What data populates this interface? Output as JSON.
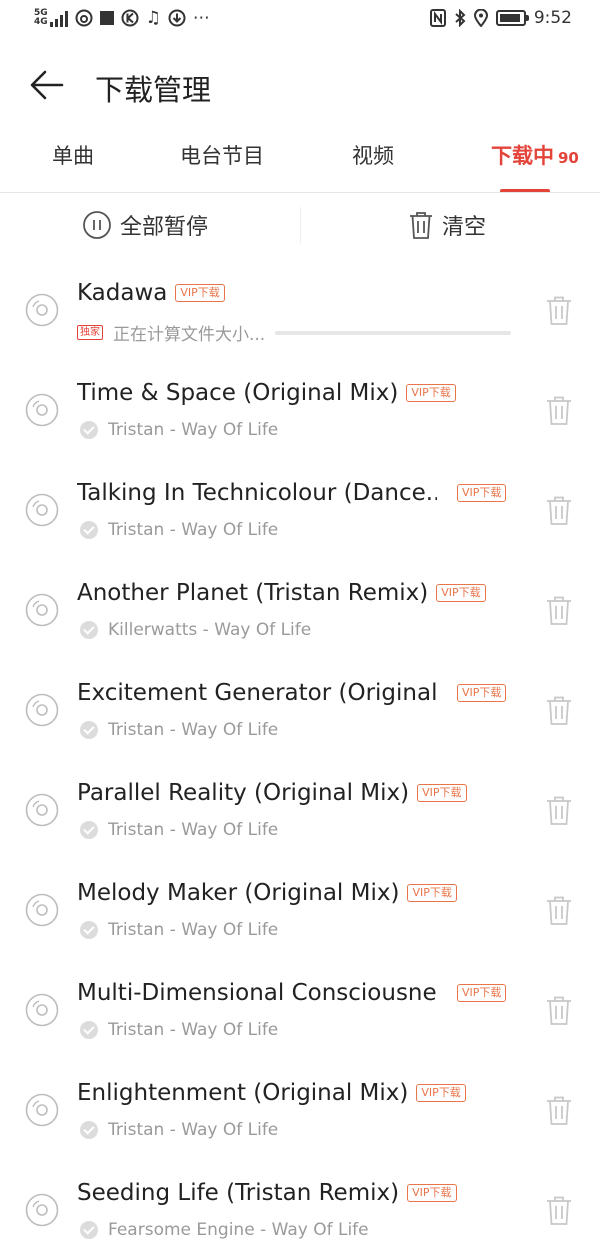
{
  "status_bar": {
    "network": "5G",
    "network_sub": "4G",
    "time": "9:52",
    "battery_level": 0.9,
    "icons": [
      "signal-icon",
      "netease-icon",
      "stop-icon",
      "k-icon",
      "music-note-icon",
      "download-arrow-icon",
      "more-dots-icon",
      "nfc-icon",
      "bluetooth-icon",
      "location-icon",
      "battery-icon"
    ]
  },
  "header": {
    "title": "下载管理",
    "back_icon": "back-arrow-icon"
  },
  "tabs": [
    {
      "label": "单曲"
    },
    {
      "label": "电台节目"
    },
    {
      "label": "视频"
    },
    {
      "label": "下载中",
      "count": "90",
      "active": true
    }
  ],
  "actions": {
    "pause_all": "全部暂停",
    "clear": "清空"
  },
  "colors": {
    "accent": "#e4433a",
    "vip": "#e8754a",
    "muted": "#9a9a9a"
  },
  "downloads": [
    {
      "title": "Kadawa",
      "vip": "VIP下载",
      "status": "正在计算文件大小...",
      "exclusive": "独家",
      "downloading": true
    },
    {
      "title": "Time & Space (Original Mix)",
      "vip": "VIP下载",
      "subtitle": "Tristan - Way Of Life"
    },
    {
      "title": "Talking In Technicolour (Dance...",
      "vip": "VIP下载",
      "subtitle": "Tristan - Way Of Life"
    },
    {
      "title": "Another Planet (Tristan Remix)",
      "vip": "VIP下载",
      "subtitle": "Killerwatts - Way Of Life"
    },
    {
      "title": "Excitement Generator (Original...",
      "vip": "VIP下载",
      "subtitle": "Tristan - Way Of Life"
    },
    {
      "title": "Parallel Reality (Original Mix)",
      "vip": "VIP下载",
      "subtitle": "Tristan - Way Of Life"
    },
    {
      "title": "Melody Maker (Original Mix)",
      "vip": "VIP下载",
      "subtitle": "Tristan - Way Of Life"
    },
    {
      "title": "Multi-Dimensional Consciousne...",
      "vip": "VIP下载",
      "subtitle": "Tristan - Way Of Life"
    },
    {
      "title": "Enlightenment (Original Mix)",
      "vip": "VIP下载",
      "subtitle": "Tristan - Way Of Life"
    },
    {
      "title": "Seeding Life (Tristan Remix)",
      "vip": "VIP下载",
      "subtitle": "Fearsome Engine - Way Of Life"
    }
  ]
}
